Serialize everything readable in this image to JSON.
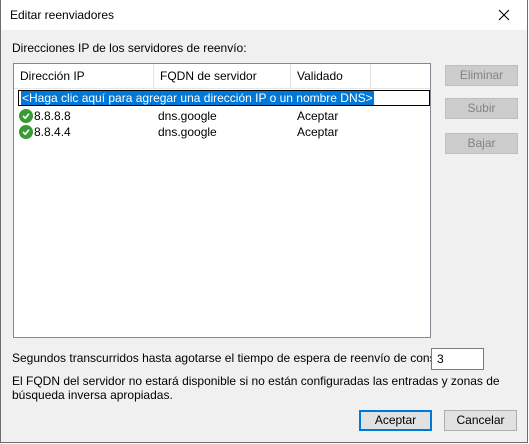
{
  "dialog": {
    "title": "Editar reenviadores",
    "section_label": "Direcciones IP de los servidores de reenvío:",
    "columns": [
      "Dirección IP",
      "FQDN de servidor",
      "Validado"
    ],
    "add_entry_placeholder": "<Haga clic aquí para agregar una dirección IP o un nombre DNS>",
    "rows": [
      {
        "ip": "8.8.8.8",
        "fqdn": "dns.google",
        "validated": "Aceptar",
        "status_icon": "check-icon"
      },
      {
        "ip": "8.8.4.4",
        "fqdn": "dns.google",
        "validated": "Aceptar",
        "status_icon": "check-icon"
      }
    ],
    "side_buttons": {
      "delete": "Eliminar",
      "up": "Subir",
      "down": "Bajar"
    },
    "timeout_label": "Segundos transcurridos hasta agotarse el tiempo de espera de reenvío de consultas:",
    "timeout_value": "3",
    "note": "El FQDN del servidor no estará disponible si no están configuradas las entradas y zonas de búsqueda inversa apropiadas.",
    "ok_label": "Aceptar",
    "cancel_label": "Cancelar"
  },
  "colors": {
    "selection": "#0078d7",
    "check": "#3a9b35",
    "window_bg": "#f0f0f0"
  }
}
